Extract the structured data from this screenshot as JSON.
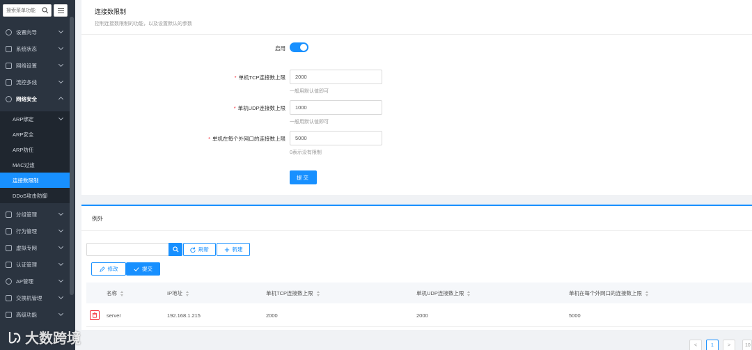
{
  "sidebar": {
    "search_placeholder": "搜索菜单功能",
    "items": [
      {
        "label": "设置向导",
        "icon": "compass-icon"
      },
      {
        "label": "系统状态",
        "icon": "monitor-icon"
      },
      {
        "label": "网络设置",
        "icon": "network-icon"
      },
      {
        "label": "流控多线",
        "icon": "flow-icon"
      },
      {
        "label": "网络安全",
        "icon": "globe-icon"
      }
    ],
    "sub_items": [
      {
        "label": "ARP绑定"
      },
      {
        "label": "ARP安全"
      },
      {
        "label": "ARP防任"
      },
      {
        "label": "MAC过滤"
      },
      {
        "label": "连接数限制"
      },
      {
        "label": "DDoS攻击防御"
      }
    ],
    "lower_items": [
      {
        "label": "分组管理",
        "icon": "group-icon"
      },
      {
        "label": "行为管理",
        "icon": "edit-icon"
      },
      {
        "label": "虚拟专网",
        "icon": "vpn-icon"
      },
      {
        "label": "认证管理",
        "icon": "auth-icon"
      },
      {
        "label": "AP管理",
        "icon": "wifi-icon"
      },
      {
        "label": "交换机管理",
        "icon": "switch-icon"
      },
      {
        "label": "高级功能",
        "icon": "advanced-icon"
      }
    ]
  },
  "form": {
    "title": "连接数限制",
    "subtitle": "控制连接数限制的功能，以及设置默认的参数",
    "enable_label": "启用",
    "enabled": true,
    "fields": [
      {
        "label": "单机TCP连接数上限",
        "value": "2000",
        "hint": "一般用默认值即可"
      },
      {
        "label": "单机UDP连接数上限",
        "value": "1000",
        "hint": "一般用默认值即可"
      },
      {
        "label": "单机在每个外网口的连接数上限",
        "value": "5000",
        "hint": "0表示没有限制"
      }
    ],
    "submit_label": "提交"
  },
  "exceptions": {
    "title": "例外",
    "search_value": "",
    "refresh_label": "刷新",
    "new_label": "新建",
    "edit_label": "修改",
    "submit_label": "提交",
    "columns": [
      "名称",
      "IP地址",
      "单机TCP连接数上限",
      "单机UDP连接数上限",
      "单机在每个外网口的连接数上限"
    ],
    "rows": [
      {
        "name": "server",
        "ip": "192.168.1.215",
        "tcp": "2000",
        "udp": "2000",
        "wan": "5000"
      }
    ]
  },
  "pagination": {
    "prev": "<",
    "current": "1",
    "next": ">",
    "page_size": "10"
  },
  "watermark": "大数跨境",
  "accent_color": "#1890ff"
}
